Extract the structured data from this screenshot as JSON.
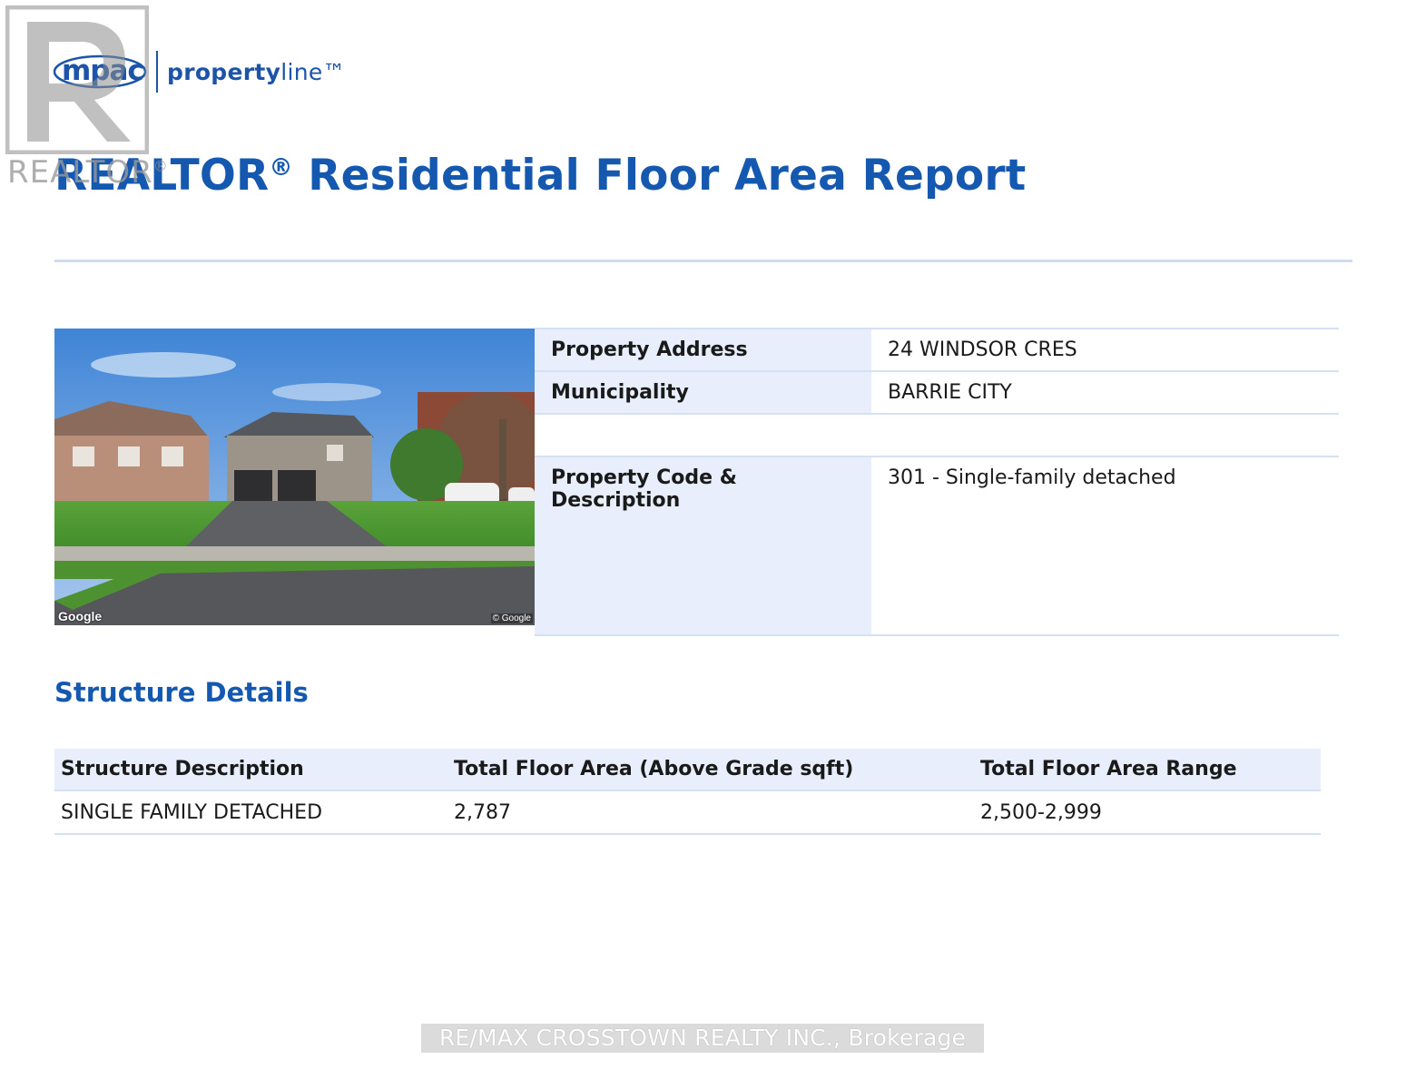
{
  "watermark": {
    "text": "REALTOR",
    "reg_mark": "®"
  },
  "brand": {
    "mpac": "mpac",
    "product_bold": "property",
    "product_light": "line™"
  },
  "report": {
    "title": "REALTOR",
    "title_reg": "®",
    "title_rest": " Residential Floor Area Report"
  },
  "photo": {
    "google_mark": "Google",
    "copyright": "© Google"
  },
  "property": {
    "rows": [
      {
        "label": "Property Address",
        "value": "24 WINDSOR CRES"
      },
      {
        "label": "Municipality",
        "value": "BARRIE CITY"
      },
      {
        "label": "",
        "value": ""
      },
      {
        "label": "Property Code & Description",
        "value": "301 - Single-family detached"
      }
    ]
  },
  "structure": {
    "section_title": "Structure Details",
    "headers": [
      "Structure Description",
      "Total Floor Area (Above Grade sqft)",
      "Total Floor Area Range"
    ],
    "rows": [
      [
        "SINGLE FAMILY DETACHED",
        "2,787",
        "2,500-2,999"
      ]
    ]
  },
  "footer": {
    "brokerage": "RE/MAX CROSSTOWN REALTY INC., Brokerage"
  },
  "colors": {
    "accent_blue": "#1558b0",
    "label_bg": "#e8eefb",
    "rule": "#d6e0f3"
  }
}
